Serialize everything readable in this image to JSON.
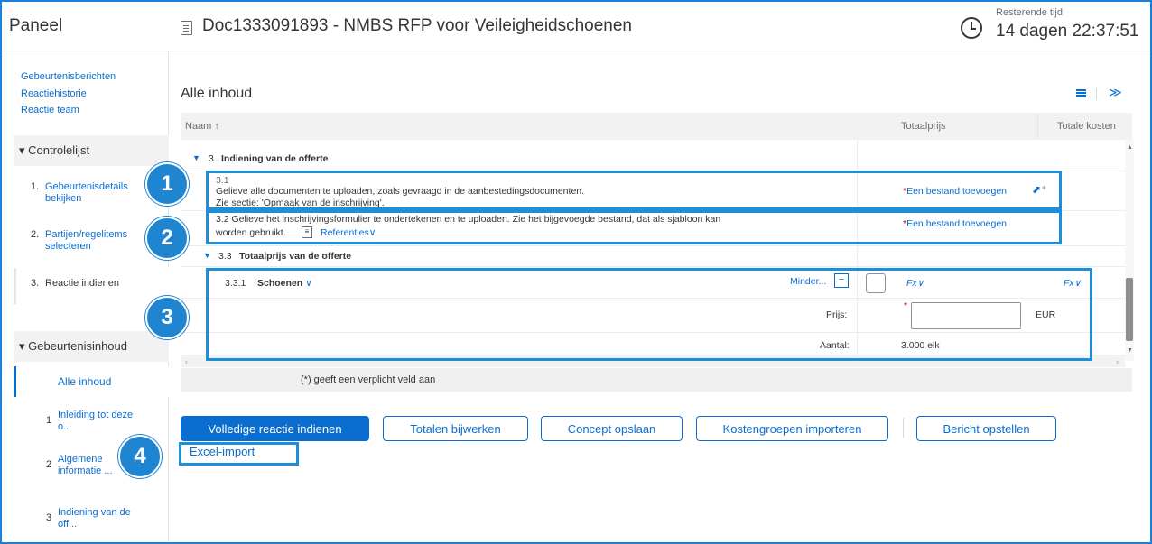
{
  "header": {
    "panel": "Paneel",
    "doc_title": "Doc1333091893 - NMBS RFP voor Veileigheidschoenen",
    "time_label": "Resterende tijd",
    "time_value": "14 dagen 22:37:51"
  },
  "sidebar": {
    "links": [
      "Gebeurtenisberichten",
      "Reactiehistorie",
      "Reactie team"
    ],
    "checklist_title": "▾ Controlelijst",
    "steps": [
      {
        "num": "1.",
        "line1": "Gebeurtenisdetails",
        "line2": "bekijken"
      },
      {
        "num": "2.",
        "line1": "Partijen/regelitems",
        "line2": "selecteren"
      },
      {
        "num": "3.",
        "line1": "Reactie indienen",
        "line2": ""
      }
    ],
    "content_title": "▾ Gebeurtenisinhoud",
    "all_content": "Alle inhoud",
    "sub_items": [
      {
        "num": "1",
        "line1": "Inleiding tot deze",
        "line2": "o..."
      },
      {
        "num": "2",
        "line1": "Algemene",
        "line2": "informatie ..."
      },
      {
        "num": "3",
        "line1": "Indiening van de",
        "line2": "off..."
      }
    ]
  },
  "main": {
    "title": "Alle inhoud",
    "columns": {
      "name": "Naam ↑",
      "total_price": "Totaalprijs",
      "total_costs": "Totale kosten"
    },
    "section3": {
      "num": "3",
      "label": "Indiening van de offerte"
    },
    "item31": {
      "num": "3.1",
      "line1": "Gelieve alle documenten te uploaden, zoals gevraagd in de aanbestedingsdocumenten.",
      "line2": "Zie sectie: 'Opmaak van de inschrijving'.",
      "action": "Een bestand toevoegen"
    },
    "item32": {
      "line1": "3.2  Gelieve het inschrijvingsformulier te ondertekenen en te uploaden. Zie het bijgevoegde bestand, dat als sjabloon kan",
      "line2": "worden gebruikt.",
      "refs": "Referenties",
      "action": "Een bestand toevoegen"
    },
    "section33": {
      "num": "3.3",
      "label": "Totaalprijs van de offerte"
    },
    "item331": {
      "num": "3.3.1",
      "label": "Schoenen",
      "less": "Minder...",
      "fx": "Fx",
      "price_label": "Prijs:",
      "currency": "EUR",
      "qty_label": "Aantal:",
      "qty_value": "3.000 elk"
    },
    "required_note": "(*) geeft een verplicht veld aan"
  },
  "buttons": {
    "submit": "Volledige reactie indienen",
    "update": "Totalen bijwerken",
    "draft": "Concept opslaan",
    "import_costs": "Kostengroepen importeren",
    "compose": "Bericht opstellen",
    "excel": "Excel-import"
  },
  "callouts": [
    "1",
    "2",
    "3",
    "4"
  ],
  "colors": {
    "accent": "#0a6ed1",
    "highlight": "#1d8fd8",
    "required": "#bb0000"
  }
}
